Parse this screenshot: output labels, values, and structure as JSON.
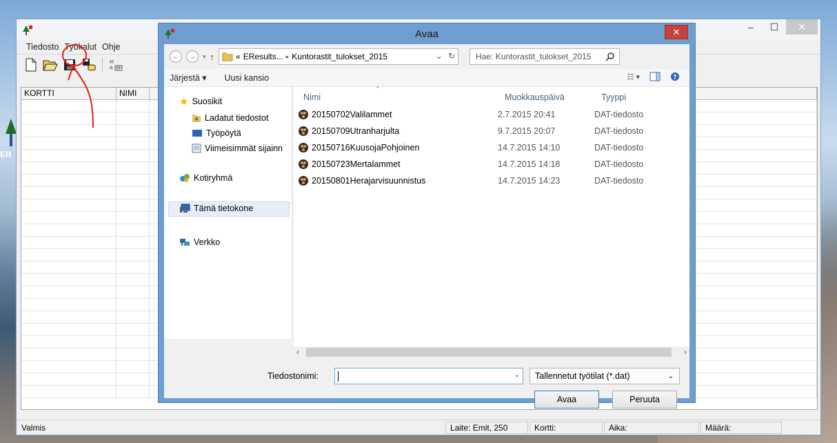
{
  "app": {
    "menu": [
      "Tiedosto",
      "Työkalut",
      "Ohje"
    ],
    "columns": [
      "KORTTI",
      "NIMI"
    ],
    "status": {
      "left": "Valmis",
      "device": "Laite: Emit, 250",
      "card": "Kortti:",
      "time": "Aika:",
      "count": "Määrä:"
    },
    "window_buttons": {
      "minimize": "–",
      "maximize": "☐",
      "close": "✕"
    }
  },
  "desktop": {
    "label": "ER"
  },
  "dialog": {
    "title": "Avaa",
    "close": "✕",
    "address": {
      "prefix": "«",
      "crumb1": "EResults...",
      "separator": "▸",
      "crumb2": "Kuntorastit_tulokset_2015"
    },
    "search_placeholder": "Hae: Kuntorastit_tulokset_2015",
    "commands": {
      "organize": "Järjestä ▾",
      "new_folder": "Uusi kansio"
    },
    "nav": {
      "favorites": "Suosikit",
      "downloads": "Ladatut tiedostot",
      "desktop": "Työpöytä",
      "recent": "Viimeisimmät sijainn",
      "homegroup": "Kotiryhmä",
      "computer": "Tämä tietokone",
      "network": "Verkko"
    },
    "file_columns": {
      "name": "Nimi",
      "date": "Muokkauspäivä",
      "type": "Tyyppi"
    },
    "files": [
      {
        "name": "20150702Valilammet",
        "date": "2.7.2015 20:41",
        "type": "DAT-tiedosto"
      },
      {
        "name": "20150709Utranharjulta",
        "date": "9.7.2015 20:07",
        "type": "DAT-tiedosto"
      },
      {
        "name": "20150716KuusojaPohjoinen",
        "date": "14.7.2015 14:10",
        "type": "DAT-tiedosto"
      },
      {
        "name": "20150723Mertalammet",
        "date": "14.7.2015 14:18",
        "type": "DAT-tiedosto"
      },
      {
        "name": "20150801Herajarvisuunnistus",
        "date": "14.7.2015 14:23",
        "type": "DAT-tiedosto"
      }
    ],
    "filename_label": "Tiedostonimi:",
    "filename_value": "",
    "filter": "Tallennetut työtilat (*.dat)",
    "open_button": "Avaa",
    "cancel_button": "Peruuta"
  },
  "colors": {
    "dialog_frame": "#6e9ed0",
    "close_red": "#c7423a",
    "annotation_red": "#e0201b"
  }
}
